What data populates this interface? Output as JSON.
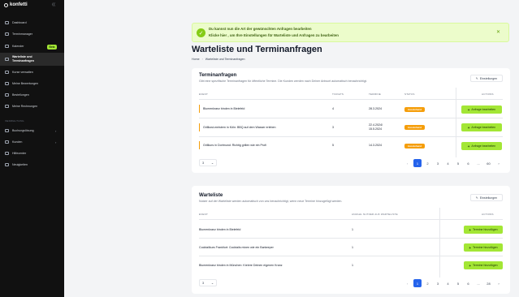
{
  "sidebar": {
    "brand": "konfetti",
    "items": [
      {
        "label": "Dashboard"
      },
      {
        "label": "Terminmanager"
      },
      {
        "label": "Kalender"
      },
      {
        "label_line1": "Warteliste und",
        "label_line2": "Terminanfragen"
      },
      {
        "label": "Kurse verwalten"
      },
      {
        "label": "Meine Bewertungen"
      },
      {
        "label": "Bestellungen"
      },
      {
        "label": "Meine Rechnungen"
      }
    ],
    "beta_badge": "Beta",
    "section_label": "VERWALTUNG",
    "admin_items": [
      {
        "label": "Buchungslösung"
      },
      {
        "label": "Kunden"
      },
      {
        "label": "Hilfecenter"
      },
      {
        "label": "Neuigkeiten"
      }
    ]
  },
  "alert": {
    "line1": "Du kannst nun die Art der gewünschten Anfragen bearbeiten",
    "line2": "Klicke hier , um Ihre Einstellungen für Warteliste und Anfragen zu bearbeiten",
    "close": "✕",
    "color": "#84cc16"
  },
  "page": {
    "title": "Warteliste und Terminanfragen",
    "breadcrumb_home": "Home",
    "breadcrumb_sep": "›",
    "breadcrumb_current": "Warteliste und Terminanfragen"
  },
  "requests": {
    "title": "Terminanfragen",
    "subtitle": "Gibt eine spezifische Terminanfragen für öffentliche Termine. Die Kunden werden nach Deiner Antwort automatisch benachrichtigt.",
    "settings_label": "Einstellungen",
    "columns": [
      "EVENT",
      "TICKETS",
      "TERMINE",
      "STATUS",
      "ACTIONS"
    ],
    "rows": [
      {
        "event": "Blumenkranz binden in Bielefeld",
        "tickets": "4",
        "dates": [
          "28.3.2024"
        ],
        "status": "Ausstehend",
        "action": "Anfrage bearbeiten"
      },
      {
        "event": "Grillkost-meistern in Köln: BBQ auf dem Wasser erleben",
        "tickets": "3",
        "dates": [
          "22.4.2024/",
          "15.5.2024"
        ],
        "status": "Ausstehend",
        "action": "Anfrage bearbeiten"
      },
      {
        "event": "Grillkurs in Dortmund: Richtig grillen wie ein Profi",
        "tickets": "5",
        "dates": [
          "14.3.2024"
        ],
        "status": "Ausstehend",
        "action": "Anfrage bearbeiten"
      }
    ],
    "per_page": "3",
    "pages": [
      "1",
      "2",
      "3",
      "4",
      "5",
      "6",
      "...",
      "60"
    ],
    "status_color": "#f59e0b"
  },
  "waitlist": {
    "title": "Warteliste",
    "subtitle": "Nutzer auf der Warteliste werden automatisch von uns benachrichtigt, wenn neue Termine hinzugefügt werden.",
    "settings_label": "Einstellungen",
    "columns": [
      "EVENT",
      "ANZAHL NUTZER AUF WARTELISTE",
      "ACTIONS"
    ],
    "rows": [
      {
        "event": "Blumenkranz binden in Bielefeld",
        "count": "1",
        "action": "Termine hinzufügen"
      },
      {
        "event": "Cocktailkurs Frankfurt: Cocktails mixen wie ein Barkeeper",
        "count": "1",
        "action": "Termine hinzufügen"
      },
      {
        "event": "Blumenkranz binden in München: Kreiere Deinen eigenen Kranz",
        "count": "1",
        "action": "Termine hinzufügen"
      }
    ],
    "per_page": "3",
    "pages": [
      "1",
      "2",
      "3",
      "4",
      "5",
      "6",
      "...",
      "28"
    ]
  },
  "accent": "#a3e635",
  "pager_active_color": "#2563eb"
}
